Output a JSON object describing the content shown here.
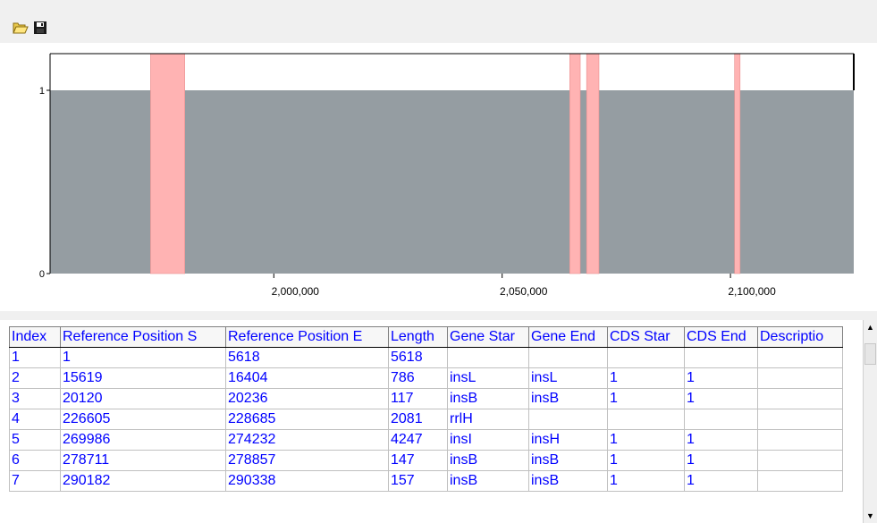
{
  "toolbar": {
    "open_icon": "folder-open-icon",
    "save_icon": "floppy-disk-icon"
  },
  "chart_data": {
    "type": "area",
    "title": "",
    "xlabel": "",
    "ylabel": "",
    "xlim": [
      1951000,
      2127000
    ],
    "ylim": [
      0,
      1
    ],
    "x_ticks": [
      2000000,
      2050000,
      2100000
    ],
    "x_tick_labels": [
      "2,000,000",
      "2,050,000",
      "2,100,000"
    ],
    "y_ticks": [
      0,
      1
    ],
    "y_tick_labels": [
      "0",
      "1"
    ],
    "coverage_level": 1,
    "colors": {
      "coverage": "#959da2",
      "gap": "#ffb3b3",
      "gap_edge": "#e88f8f"
    },
    "gaps": [
      {
        "start": 1973000,
        "end": 1980500
      },
      {
        "start": 2064800,
        "end": 2067100
      },
      {
        "start": 2068500,
        "end": 2071200
      },
      {
        "start": 2100900,
        "end": 2102100
      }
    ]
  },
  "table": {
    "columns": [
      "Index",
      "Reference Position S",
      "Reference Position E",
      "Length",
      "Gene Star",
      "Gene End",
      "CDS Star",
      "CDS End",
      "Descriptio"
    ],
    "rows": [
      [
        "1",
        "1",
        "5618",
        "5618",
        "",
        "",
        "",
        "",
        ""
      ],
      [
        "2",
        "15619",
        "16404",
        "786",
        "insL",
        "insL",
        "1",
        "1",
        ""
      ],
      [
        "3",
        "20120",
        "20236",
        "117",
        "insB",
        "insB",
        "1",
        "1",
        ""
      ],
      [
        "4",
        "226605",
        "228685",
        "2081",
        "rrlH",
        "",
        "",
        "",
        ""
      ],
      [
        "5",
        "269986",
        "274232",
        "4247",
        "insI",
        "insH",
        "1",
        "1",
        ""
      ],
      [
        "6",
        "278711",
        "278857",
        "147",
        "insB",
        "insB",
        "1",
        "1",
        ""
      ],
      [
        "7",
        "290182",
        "290338",
        "157",
        "insB",
        "insB",
        "1",
        "1",
        ""
      ]
    ]
  },
  "scrollbar": {
    "up_icon": "arrow-up-icon",
    "down_icon": "arrow-down-icon"
  }
}
